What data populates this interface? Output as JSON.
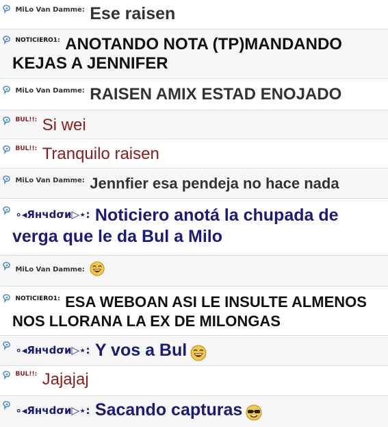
{
  "colors": {
    "text_dark": "#333333",
    "text_black": "#111111",
    "text_red": "#8b1c1c",
    "text_navy": "#1a1a7a",
    "icon_blue": "#3a86c8",
    "divider": "#dcdcdc"
  },
  "messages": [
    {
      "user": "MiLo Van Damme:",
      "text": "Ese raisen",
      "continuation": ""
    },
    {
      "user": "NOTICIERO1:",
      "text": "ANOTANDO NOTA (TP)MANDANDO",
      "continuation": "KEJAS A JENNIFER"
    },
    {
      "user": "MiLo Van Damme:",
      "text": "RAISEN AMIX ESTAD ENOJADO",
      "continuation": ""
    },
    {
      "user": "BUL!!:",
      "text": "Si wei",
      "continuation": ""
    },
    {
      "user": "BUL!!:",
      "text": "Tranquilo raisen",
      "continuation": ""
    },
    {
      "user": "MiLo Van Damme:",
      "text": "Jennfier esa pendeja no hace nada",
      "continuation": ""
    },
    {
      "user": "∘◂Янчdσи▷⋆:",
      "text": "Noticiero anotá la chupada de",
      "continuation": "verga que le da Bul a Milo"
    },
    {
      "user": "MiLo Van Damme:",
      "text": "",
      "continuation": "",
      "emoji": "laughing-face-emoji"
    },
    {
      "user": "NOTICIERO1:",
      "text": "ESA WEBOAN ASI LE INSULTE ALMENOS",
      "continuation": "NOS LLORANA LA EX DE MILONGAS"
    },
    {
      "user": "∘◂Янчdσи▷⋆:",
      "text": "Y vos a Bul",
      "continuation": "",
      "emoji": "laughing-face-emoji"
    },
    {
      "user": "BUL!!:",
      "text": "Jajajaj",
      "continuation": ""
    },
    {
      "user": "∘◂Янчdσи▷⋆:",
      "text": "Sacando capturas",
      "continuation": "",
      "emoji": "cool-sunglasses-emoji"
    }
  ]
}
